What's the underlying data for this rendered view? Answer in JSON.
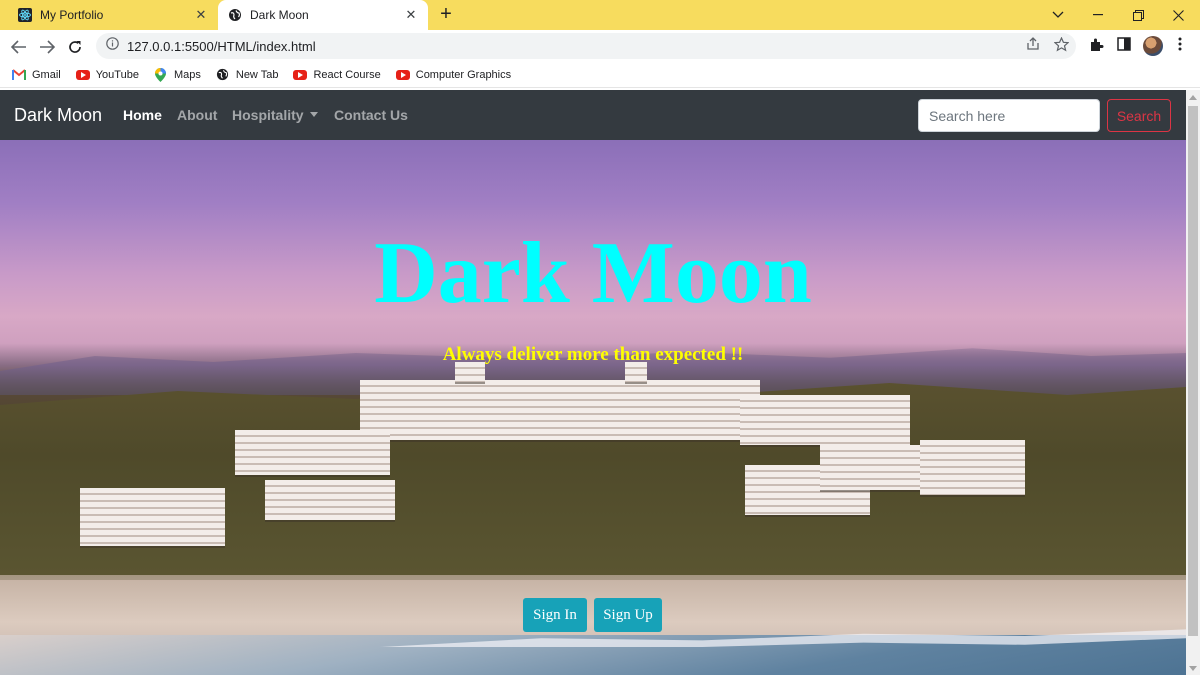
{
  "browser": {
    "tabs": [
      {
        "title": "My Portfolio",
        "active": false,
        "favicon": "react-icon"
      },
      {
        "title": "Dark Moon",
        "active": true,
        "favicon": "globe-icon"
      }
    ],
    "url": "127.0.0.1:5500/HTML/index.html",
    "bookmarks": [
      {
        "label": "Gmail",
        "icon": "gmail-icon"
      },
      {
        "label": "YouTube",
        "icon": "youtube-icon"
      },
      {
        "label": "Maps",
        "icon": "maps-icon"
      },
      {
        "label": "New Tab",
        "icon": "globe-icon"
      },
      {
        "label": "React Course",
        "icon": "youtube-icon"
      },
      {
        "label": "Computer Graphics",
        "icon": "youtube-icon"
      }
    ],
    "colors": {
      "tab_strip": "#f7dc5e"
    }
  },
  "site": {
    "brand": "Dark Moon",
    "nav": {
      "home": "Home",
      "about": "About",
      "hospitality": "Hospitality",
      "contact": "Contact Us"
    },
    "search": {
      "placeholder": "Search here",
      "button": "Search"
    },
    "hero": {
      "title": "Dark Moon",
      "subtitle": "Always deliver more than expected !!",
      "sign_in": "Sign In",
      "sign_up": "Sign Up"
    },
    "colors": {
      "navbar": "#343a40",
      "title": "#00ffff",
      "subtitle": "#ffff00",
      "button": "#17a2b8",
      "search_outline": "#dc3545"
    }
  }
}
